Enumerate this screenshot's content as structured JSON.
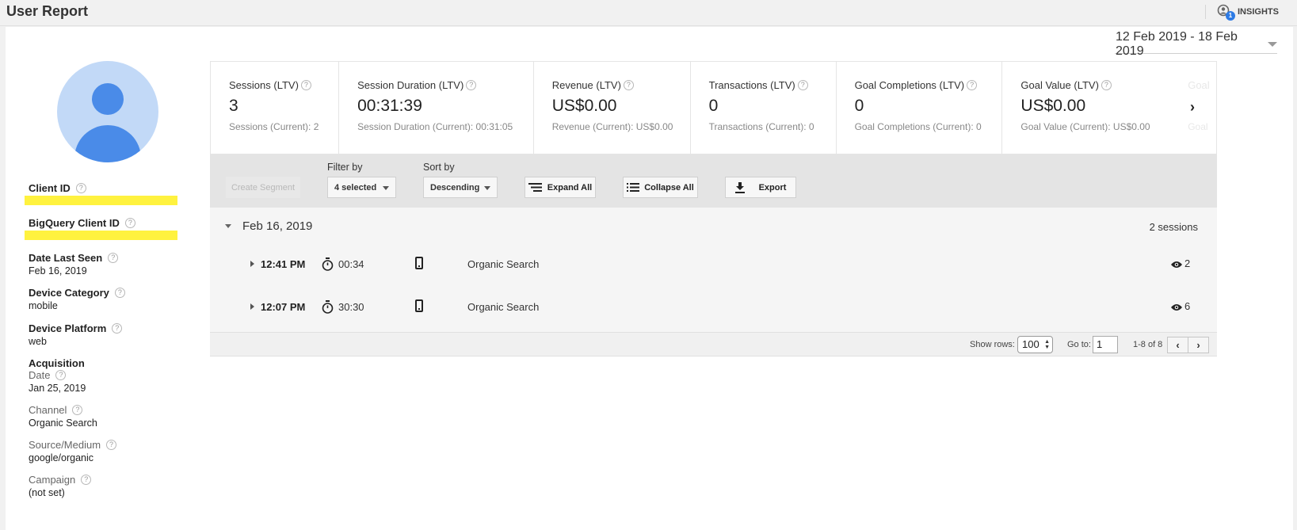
{
  "header": {
    "title": "User Report",
    "insights_label": "INSIGHTS",
    "insights_badge": "1"
  },
  "date_range": "12 Feb 2019 - 18 Feb 2019",
  "sidebar": {
    "client_id_label": "Client ID",
    "bigquery_client_id_label": "BigQuery Client ID",
    "date_last_seen_label": "Date Last Seen",
    "date_last_seen_value": "Feb 16, 2019",
    "device_category_label": "Device Category",
    "device_category_value": "mobile",
    "device_platform_label": "Device Platform",
    "device_platform_value": "web",
    "acquisition_label": "Acquisition",
    "acq_date_label": "Date",
    "acq_date_value": "Jan 25, 2019",
    "channel_label": "Channel",
    "channel_value": "Organic Search",
    "source_medium_label": "Source/Medium",
    "source_medium_value": "google/organic",
    "campaign_label": "Campaign",
    "campaign_value": "(not set)"
  },
  "metrics": [
    {
      "label": "Sessions (LTV)",
      "value": "3",
      "sub": "Sessions (Current): 2"
    },
    {
      "label": "Session Duration (LTV)",
      "value": "00:31:39",
      "sub": "Session Duration (Current): 00:31:05"
    },
    {
      "label": "Revenue (LTV)",
      "value": "US$0.00",
      "sub": "Revenue (Current): US$0.00"
    },
    {
      "label": "Transactions (LTV)",
      "value": "0",
      "sub": "Transactions (Current): 0"
    },
    {
      "label": "Goal Completions (LTV)",
      "value": "0",
      "sub": "Goal Completions (Current): 0"
    },
    {
      "label": "Goal Value (LTV)",
      "value": "US$0.00",
      "sub": "Goal Value (Current): US$0.00"
    },
    {
      "label": "Goal",
      "value": "",
      "sub": "Goal"
    }
  ],
  "metrics_next": "›",
  "toolbar": {
    "create_segment": "Create Segment",
    "filter_by_label": "Filter by",
    "filter_by_value": "4 selected",
    "sort_by_label": "Sort by",
    "sort_by_value": "Descending",
    "expand_all": "Expand All",
    "collapse_all": "Collapse All",
    "export": "Export"
  },
  "day": {
    "date": "Feb 16, 2019",
    "count": "2 sessions",
    "sessions": [
      {
        "time": "12:41 PM",
        "duration": "00:34",
        "channel": "Organic Search",
        "views": "2"
      },
      {
        "time": "12:07 PM",
        "duration": "30:30",
        "channel": "Organic Search",
        "views": "6"
      }
    ]
  },
  "pager": {
    "show_rows_label": "Show rows:",
    "show_rows_value": "100",
    "goto_label": "Go to:",
    "goto_value": "1",
    "range": "1-8 of 8",
    "prev": "‹",
    "next": "›"
  },
  "colors": {
    "avatar_bg": "#c2d9f7",
    "avatar_fg": "#4a8be8",
    "redaction": "#fff23f",
    "badge": "#2d7be5"
  }
}
